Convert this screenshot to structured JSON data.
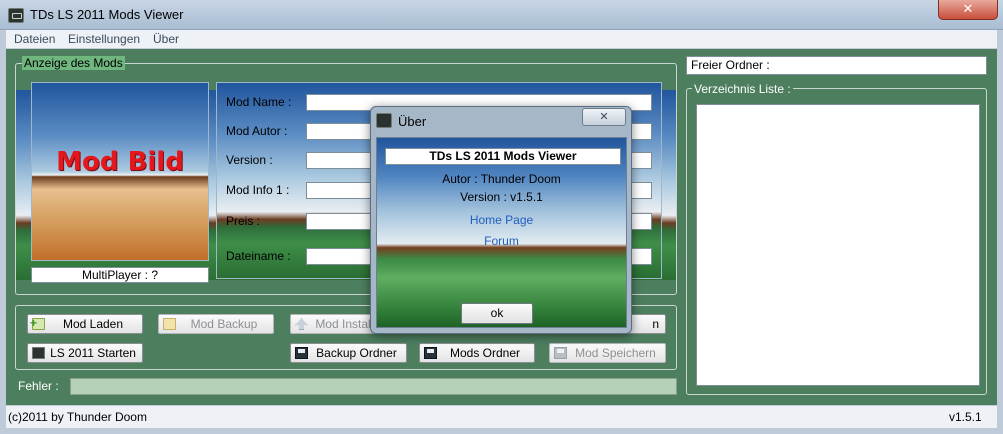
{
  "window": {
    "title": "TDs LS 2011 Mods Viewer",
    "close_glyph": "✕"
  },
  "menu": {
    "items": [
      "Dateien",
      "Einstellungen",
      "Über"
    ]
  },
  "mod_group": {
    "legend": "Anzeige des Mods",
    "image_label": "Mod Bild",
    "multiplayer": "MultiPlayer : ?",
    "fields": {
      "name_label": "Mod Name :",
      "author_label": "Mod Autor :",
      "version_label": "Version :",
      "info_label": "Mod Info 1 :",
      "price_label": "Preis :",
      "file_label": "Dateiname :"
    }
  },
  "buttons": {
    "load": "Mod Laden",
    "backup": "Mod Backup",
    "install": "Mod Instal",
    "hidden_right_top": "n",
    "start": "LS 2011 Starten",
    "backup_folder": "Backup Ordner",
    "mods_folder": "Mods Ordner",
    "save": "Mod Speichern"
  },
  "error": {
    "label": "Fehler :"
  },
  "right_panel": {
    "folder_field": "Freier Ordner :",
    "list_legend": "Verzeichnis Liste :"
  },
  "status": {
    "copyright": "(c)2011 by Thunder Doom",
    "version": "v1.5.1"
  },
  "dialog": {
    "title": "Über",
    "close_glyph": "✕",
    "app_name": "TDs LS 2011 Mods Viewer",
    "author": "Autor : Thunder Doom",
    "version": "Version : v1.5.1",
    "home_link": "Home Page",
    "forum_link": "Forum",
    "ok_label": "ok"
  }
}
